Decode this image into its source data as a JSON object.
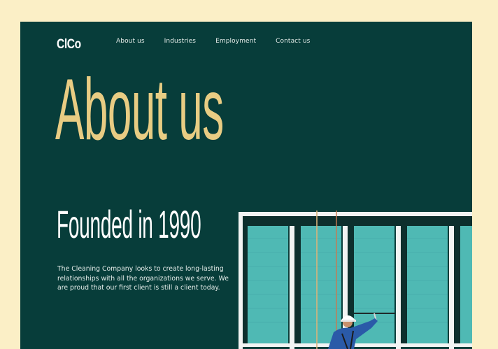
{
  "brand": {
    "logo": "ClCo"
  },
  "nav": {
    "items": [
      "About us",
      "Industries",
      "Employment",
      "Contact us"
    ]
  },
  "hero": {
    "title": "About us"
  },
  "section": {
    "heading": "Founded in 1990",
    "body": "The Cleaning Company looks to create long-lasting relationships with all the organizations we serve. We are proud that our first client is still a client today."
  },
  "colors": {
    "page_bg": "#fbefc6",
    "panel_bg": "#073d3a",
    "accent": "#e8cc83",
    "glass": "#4fb9b4",
    "frame": "#f2f4f3",
    "worker": "#2a5aa8"
  },
  "image": {
    "subject": "window-cleaner-photo"
  }
}
